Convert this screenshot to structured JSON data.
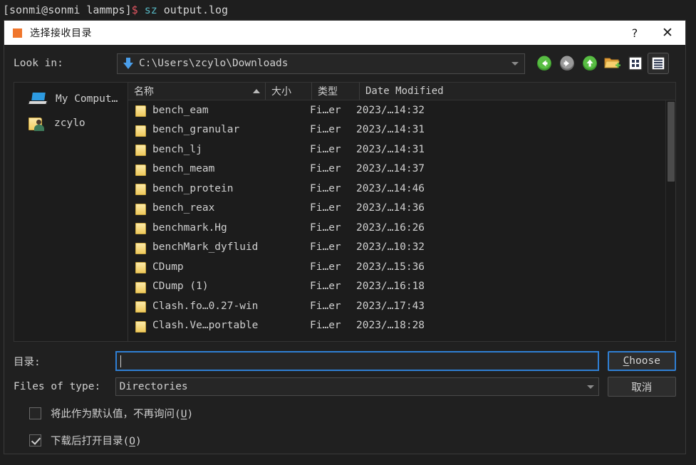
{
  "terminal": {
    "prompt": "[sonmi@sonmi lammps]",
    "dollar": "$",
    "command": "sz",
    "argument": "output.log"
  },
  "dialog": {
    "title": "选择接收目录",
    "title_icon": "orange-square-icon",
    "help_button": "?",
    "close_button": "✕",
    "accent_color": "#2f7fd4",
    "title_icon_color": "#f0762c"
  },
  "lookin": {
    "label": "Look in:",
    "path": "C:\\Users\\zcylo\\Downloads",
    "drive_icon": "blue-down-arrow-drive-icon"
  },
  "toolbar": {
    "buttons": [
      {
        "name": "back-button",
        "icon": "left-arrow-icon",
        "state": "enabled"
      },
      {
        "name": "forward-button",
        "icon": "right-arrow-icon",
        "state": "disabled"
      },
      {
        "name": "parent-dir-button",
        "icon": "up-arrow-icon",
        "state": "enabled"
      },
      {
        "name": "new-folder-button",
        "icon": "new-folder-icon",
        "state": "enabled"
      },
      {
        "name": "list-view-button",
        "icon": "grid-view-icon",
        "state": "enabled"
      },
      {
        "name": "detail-view-button",
        "icon": "detail-view-icon",
        "state": "selected"
      }
    ]
  },
  "sidebar": {
    "items": [
      {
        "label": "My Comput…",
        "icon": "computer-icon"
      },
      {
        "label": "zcylo",
        "icon": "user-folder-icon"
      }
    ]
  },
  "filelist": {
    "columns": [
      {
        "key": "name",
        "label": "名称",
        "sorted": "asc"
      },
      {
        "key": "size",
        "label": "大小"
      },
      {
        "key": "type",
        "label": "类型"
      },
      {
        "key": "date",
        "label": "Date Modified"
      }
    ],
    "rows": [
      {
        "name": "bench_eam",
        "size": "",
        "type": "Fi…er",
        "date": "2023/…14:32"
      },
      {
        "name": "bench_granular",
        "size": "",
        "type": "Fi…er",
        "date": "2023/…14:31"
      },
      {
        "name": "bench_lj",
        "size": "",
        "type": "Fi…er",
        "date": "2023/…14:31"
      },
      {
        "name": "bench_meam",
        "size": "",
        "type": "Fi…er",
        "date": "2023/…14:37"
      },
      {
        "name": "bench_protein",
        "size": "",
        "type": "Fi…er",
        "date": "2023/…14:46"
      },
      {
        "name": "bench_reax",
        "size": "",
        "type": "Fi…er",
        "date": "2023/…14:36"
      },
      {
        "name": "benchmark.Hg",
        "size": "",
        "type": "Fi…er",
        "date": "2023/…16:26"
      },
      {
        "name": "benchMark_dyfluid",
        "size": "",
        "type": "Fi…er",
        "date": "2023/…10:32"
      },
      {
        "name": "CDump",
        "size": "",
        "type": "Fi…er",
        "date": "2023/…15:36"
      },
      {
        "name": "CDump (1)",
        "size": "",
        "type": "Fi…er",
        "date": "2023/…16:18"
      },
      {
        "name": "Clash.fo…0.27-win",
        "size": "",
        "type": "Fi…er",
        "date": "2023/…17:43"
      },
      {
        "name": "Clash.Ve…portable",
        "size": "",
        "type": "Fi…er",
        "date": "2023/…18:28"
      }
    ]
  },
  "form": {
    "dir_label": "目录:",
    "dir_value": "",
    "type_label": "Files of type:",
    "type_value": "Directories",
    "choose_button": "Choose",
    "choose_mnemonic": "C",
    "choose_rest": "hoose",
    "cancel_button": "取消"
  },
  "checkboxes": [
    {
      "label_pre": "将此作为默认值，不再询问(",
      "mnemonic": "U",
      "label_post": ")",
      "checked": false
    },
    {
      "label_pre": "下载后打开目录(",
      "mnemonic": "O",
      "label_post": ")",
      "checked": true
    }
  ]
}
